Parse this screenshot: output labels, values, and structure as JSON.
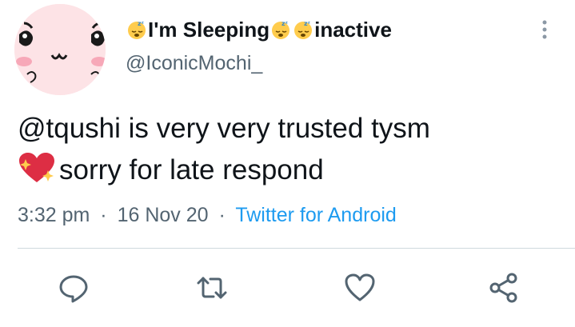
{
  "user": {
    "display_name_prefix_emoji": "sleeping-face-emoji",
    "display_name": "I'm Sleeping",
    "display_name_suffix": "inactive",
    "handle": "@IconicMochi_"
  },
  "tweet": {
    "line1": "@tqushi is very very trusted tysm",
    "line2": "sorry for late respond",
    "emoji": "sparkling-heart-emoji"
  },
  "meta": {
    "time": "3:32 pm",
    "separator": "·",
    "date": "16 Nov 20",
    "source": "Twitter for Android"
  },
  "colors": {
    "text": "#0f1419",
    "secondary": "#536471",
    "link": "#1d9bf0",
    "divider": "#cfd9de",
    "avatar_bg": "#fde3e6"
  },
  "actions": [
    {
      "icon": "reply-icon"
    },
    {
      "icon": "retweet-icon"
    },
    {
      "icon": "like-icon"
    },
    {
      "icon": "share-icon"
    }
  ]
}
